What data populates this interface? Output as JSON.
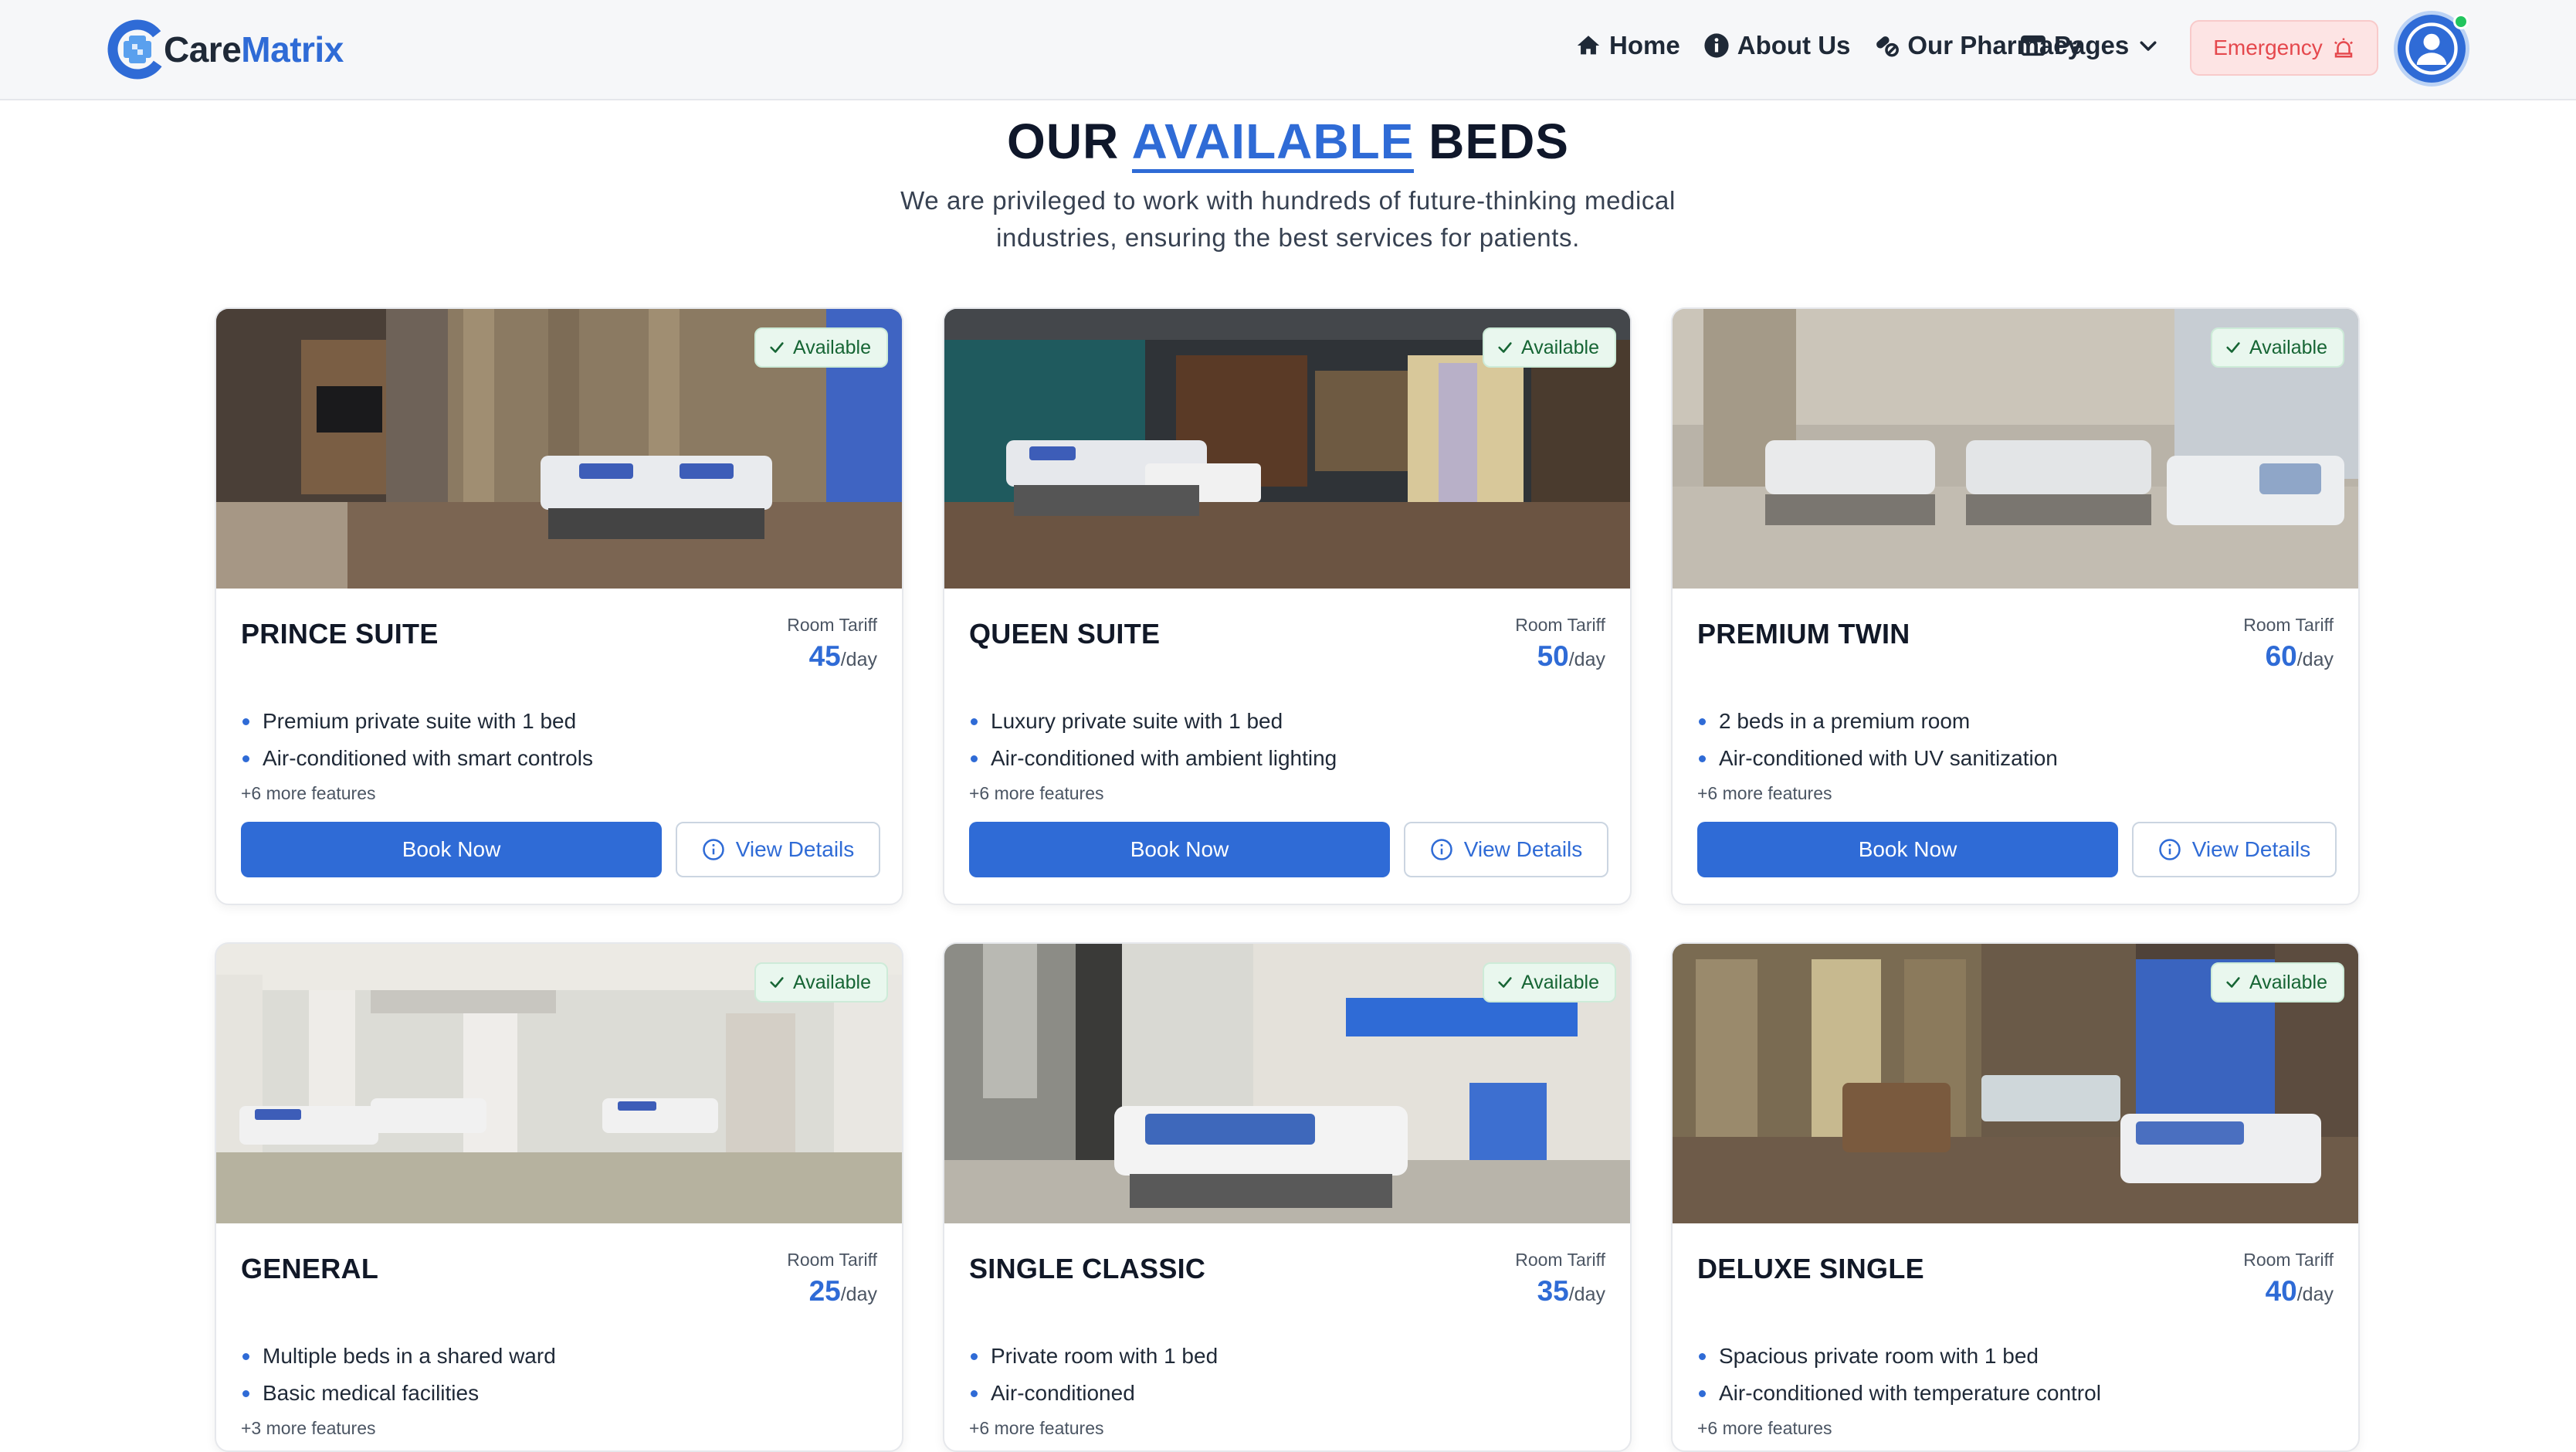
{
  "brand": {
    "name_part1": "Care",
    "name_part2": "Matrix",
    "logo_icon": "medical-cross-logo"
  },
  "nav": {
    "home": "Home",
    "about": "About Us",
    "pharmacy": "Our Pharmacy",
    "pages": "Pages",
    "emergency": "Emergency"
  },
  "heading": {
    "part1": "OUR",
    "accent": "AVAILABLE",
    "part2": "BEDS"
  },
  "subtitle": "We are privileged to work with hundreds of future-thinking medical industries, ensuring the best services for patients.",
  "labels": {
    "room_tariff": "Room Tariff",
    "per_day": "/day",
    "book_now": "Book Now",
    "view_details": "View Details",
    "available": "Available"
  },
  "colors": {
    "accent": "#2f6bd6",
    "available_green": "#166534",
    "emergency_red": "#e5484d"
  },
  "rooms": [
    {
      "name": "PRINCE SUITE",
      "price": "45",
      "features": [
        "Premium private suite with 1 bed",
        "Air-conditioned with smart controls"
      ],
      "more": "+6 more features",
      "status": "Available"
    },
    {
      "name": "QUEEN SUITE",
      "price": "50",
      "features": [
        "Luxury private suite with 1 bed",
        "Air-conditioned with ambient lighting"
      ],
      "more": "+6 more features",
      "status": "Available"
    },
    {
      "name": "PREMIUM TWIN",
      "price": "60",
      "features": [
        "2 beds in a premium room",
        "Air-conditioned with UV sanitization"
      ],
      "more": "+6 more features",
      "status": "Available"
    },
    {
      "name": "GENERAL",
      "price": "25",
      "features": [
        "Multiple beds in a shared ward",
        "Basic medical facilities"
      ],
      "more": "+3 more features",
      "status": "Available"
    },
    {
      "name": "SINGLE CLASSIC",
      "price": "35",
      "features": [
        "Private room with 1 bed",
        "Air-conditioned"
      ],
      "more": "+6 more features",
      "status": "Available"
    },
    {
      "name": "DELUXE SINGLE",
      "price": "40",
      "features": [
        "Spacious private room with 1 bed",
        "Air-conditioned with temperature control"
      ],
      "more": "+6 more features",
      "status": "Available"
    }
  ]
}
